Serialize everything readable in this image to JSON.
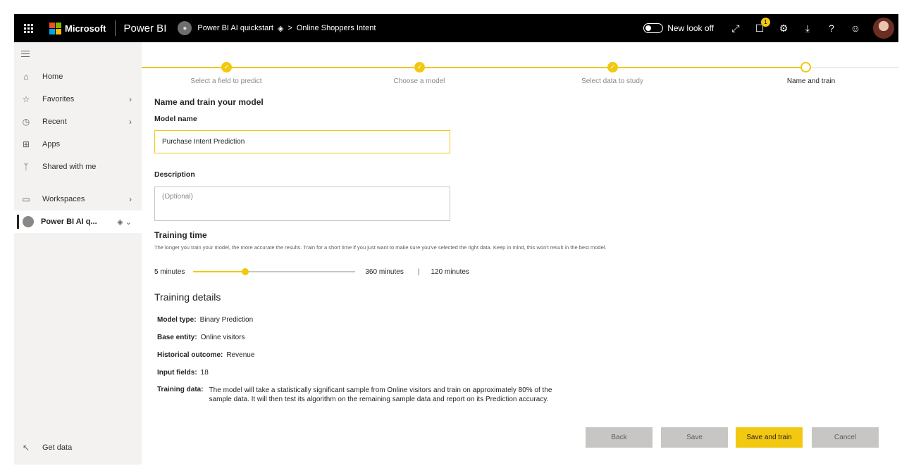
{
  "topbar": {
    "brand": "Microsoft",
    "product": "Power BI",
    "workspace": "Power BI AI quickstart",
    "crumb_sep": ">",
    "dataset": "Online Shoppers Intent",
    "new_look_label": "New look off",
    "notification_count": "1"
  },
  "sidebar": {
    "items": [
      {
        "label": "Home",
        "icon": "home-icon"
      },
      {
        "label": "Favorites",
        "icon": "star-icon"
      },
      {
        "label": "Recent",
        "icon": "clock-icon"
      },
      {
        "label": "Apps",
        "icon": "apps-icon"
      },
      {
        "label": "Shared with me",
        "icon": "shared-icon"
      },
      {
        "label": "Workspaces",
        "icon": "workspaces-icon"
      },
      {
        "label": "Power BI AI q...",
        "icon": "workspace-avatar-icon"
      }
    ],
    "get_data": "Get data"
  },
  "stepper": {
    "steps": [
      {
        "label": "Select a field to predict",
        "state": "done"
      },
      {
        "label": "Choose a model",
        "state": "done"
      },
      {
        "label": "Select data to study",
        "state": "done"
      },
      {
        "label": "Name and train",
        "state": "current"
      }
    ],
    "colors": {
      "accent": "#f2c811",
      "track": "#edebe9"
    }
  },
  "form": {
    "section_title": "Name and train your model",
    "model_name_label": "Model name",
    "model_name_value": "Purchase Intent Prediction",
    "description_label": "Description",
    "description_placeholder": "(Optional)",
    "training_time_label": "Training time",
    "training_time_help": "The longer you train your model, the more accurate the results. Train for a short time if you just want to make sure you've selected the right data. Keep in mind, this won't result in the best model.",
    "slider": {
      "min_label": "5 minutes",
      "max_label": "360 minutes",
      "separator": "|",
      "value_label": "120 minutes",
      "value_fraction": 0.32
    }
  },
  "details": {
    "title": "Training details",
    "model_type_label": "Model type:",
    "model_type": "Binary Prediction",
    "base_entity_label": "Base entity:",
    "base_entity": "Online visitors",
    "historical_outcome_label": "Historical outcome:",
    "historical_outcome": "Revenue",
    "input_fields_label": "Input fields:",
    "input_fields": "18",
    "training_data_label": "Training data:",
    "training_data_line1": "The model will take a statistically significant sample from Online visitors and train on approximately 80% of the",
    "training_data_line2": "sample data. It will then test its algorithm on the remaining sample data and report on its Prediction accuracy."
  },
  "buttons": {
    "back": "Back",
    "save": "Save",
    "save_and_train": "Save and train",
    "cancel": "Cancel"
  }
}
